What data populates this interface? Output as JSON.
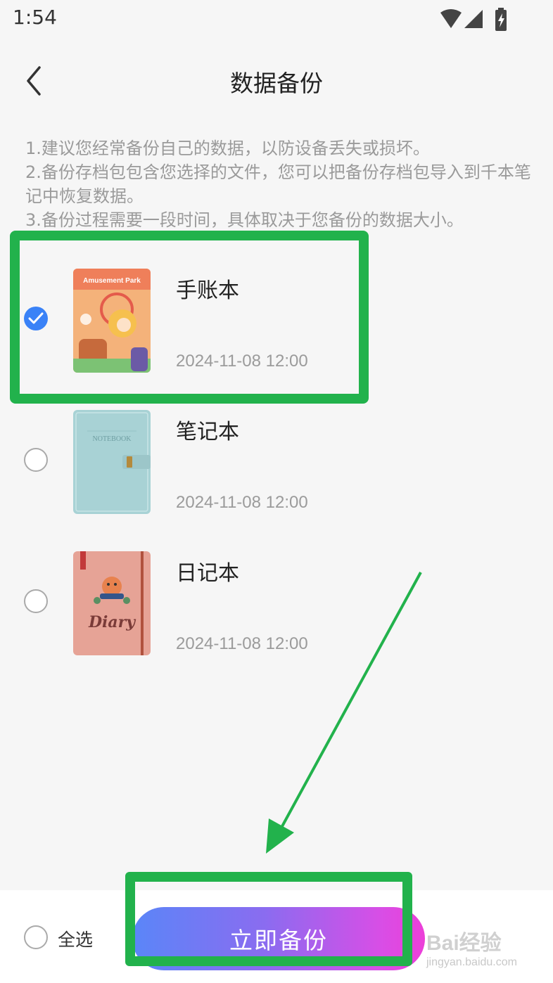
{
  "status": {
    "time": "1:54"
  },
  "header": {
    "title": "数据备份"
  },
  "description": [
    "1.建议您经常备份自己的数据，以防设备丢失或损坏。",
    "2.备份存档包包含您选择的文件，您可以把备份存档包导入到千本笔记中恢复数据。",
    "3.备份过程需要一段时间，具体取决于您备份的数据大小。"
  ],
  "notebooks": [
    {
      "name": "手账本",
      "date": "2024-11-08 12:00",
      "checked": true,
      "cover_text": "Amusement Park",
      "cover_color": "#f2a46a"
    },
    {
      "name": "笔记本",
      "date": "2024-11-08 12:00",
      "checked": false,
      "cover_text": "NOTEBOOK",
      "cover_color": "#a9d3d6"
    },
    {
      "name": "日记本",
      "date": "2024-11-08 12:00",
      "checked": false,
      "cover_text": "Diary",
      "cover_color": "#e9a79c"
    }
  ],
  "bottom": {
    "select_all_label": "全选",
    "backup_button_label": "立即备份"
  },
  "watermark": {
    "main": "Bai经验",
    "sub": "jingyan.baidu.com"
  },
  "colors": {
    "accent": "#3a82f7",
    "annotation": "#22b24c"
  }
}
